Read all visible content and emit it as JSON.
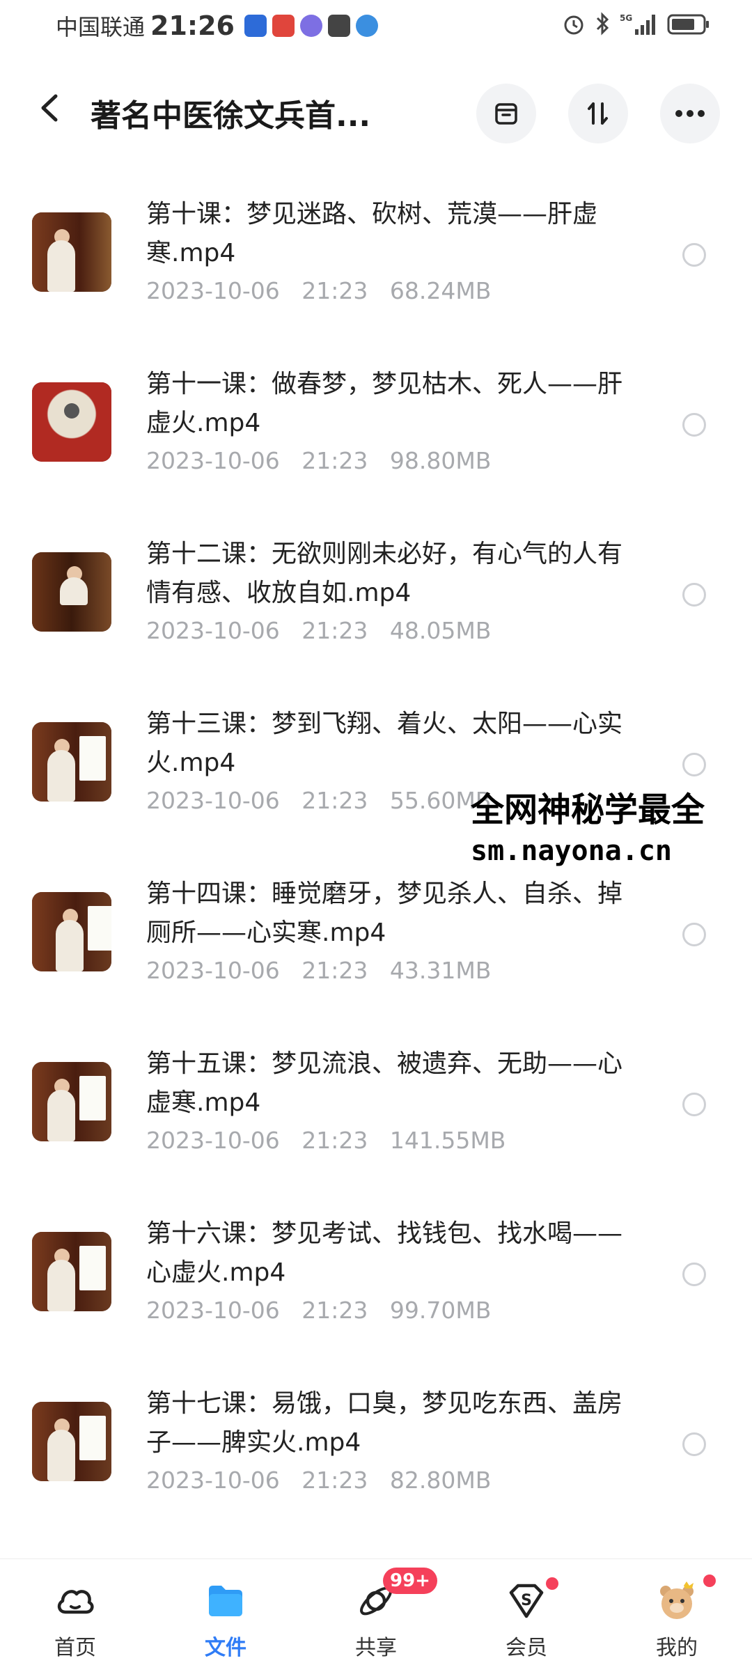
{
  "status_bar": {
    "carrier": "中国联通",
    "time": "21:26",
    "network": "5G"
  },
  "header": {
    "title": "著名中医徐文兵首...",
    "back_icon": "chevron-left-icon",
    "actions": [
      "archive-icon",
      "sort-icon",
      "more-icon"
    ]
  },
  "files": [
    {
      "name": "第十课：梦见迷路、砍树、荒漠——肝虚寒.mp4",
      "date": "2023-10-06",
      "time": "21:23",
      "size": "68.24MB"
    },
    {
      "name": "第十一课：做春梦，梦见枯木、死人——肝虚火.mp4",
      "date": "2023-10-06",
      "time": "21:23",
      "size": "98.80MB"
    },
    {
      "name": "第十二课：无欲则刚未必好，有心气的人有情有感、收放自如.mp4",
      "date": "2023-10-06",
      "time": "21:23",
      "size": "48.05MB"
    },
    {
      "name": "第十三课：梦到飞翔、着火、太阳——心实火.mp4",
      "date": "2023-10-06",
      "time": "21:23",
      "size": "55.60MB"
    },
    {
      "name": "第十四课：睡觉磨牙，梦见杀人、自杀、掉厕所——心实寒.mp4",
      "date": "2023-10-06",
      "time": "21:23",
      "size": "43.31MB"
    },
    {
      "name": "第十五课：梦见流浪、被遗弃、无助——心虚寒.mp4",
      "date": "2023-10-06",
      "time": "21:23",
      "size": "141.55MB"
    },
    {
      "name": "第十六课：梦见考试、找钱包、找水喝——心虚火.mp4",
      "date": "2023-10-06",
      "time": "21:23",
      "size": "99.70MB"
    },
    {
      "name": "第十七课：易饿，口臭，梦见吃东西、盖房子——脾实火.mp4",
      "date": "2023-10-06",
      "time": "21:23",
      "size": "82.80MB"
    }
  ],
  "watermark": {
    "line1": "全网神秘学最全",
    "line2": "sm.nayona.cn"
  },
  "tabbar": {
    "tabs": [
      {
        "label": "首页",
        "icon": "cloud-home-icon"
      },
      {
        "label": "文件",
        "icon": "folder-icon"
      },
      {
        "label": "共享",
        "icon": "share-orbit-icon",
        "badge": "99+"
      },
      {
        "label": "会员",
        "icon": "vip-diamond-icon"
      },
      {
        "label": "我的",
        "icon": "bear-avatar-icon"
      }
    ],
    "active_index": 1
  },
  "colors": {
    "accent": "#2f7cf6",
    "badge": "#f5405a",
    "meta_text": "#a7a9ad"
  }
}
